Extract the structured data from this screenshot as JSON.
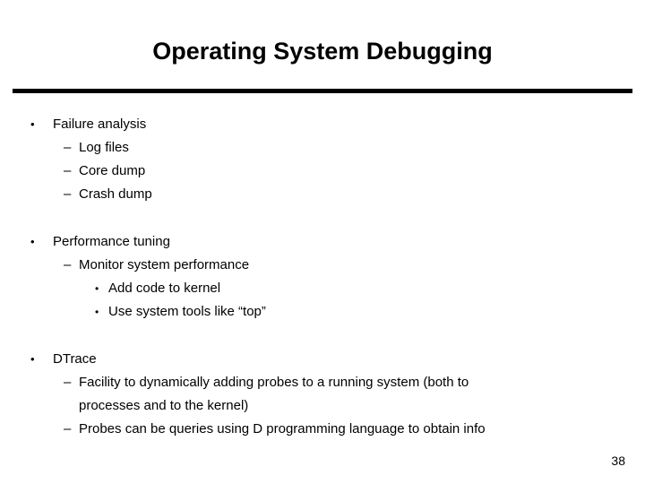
{
  "slide": {
    "title": "Operating System Debugging",
    "page_number": "38",
    "text_color": "#000000",
    "background_color": "#ffffff",
    "rule_color": "#000000",
    "markers": {
      "level1": "•",
      "level2": "–",
      "level3": "•"
    },
    "sections": [
      {
        "heading": "Failure analysis",
        "items": [
          {
            "level": 2,
            "text": "Log files"
          },
          {
            "level": 2,
            "text": "Core dump"
          },
          {
            "level": 2,
            "text": "Crash dump"
          }
        ]
      },
      {
        "heading": "Performance tuning",
        "items": [
          {
            "level": 2,
            "text": "Monitor system performance"
          },
          {
            "level": 3,
            "text": "Add code to kernel"
          },
          {
            "level": 3,
            "text": "Use system tools like “top”"
          }
        ]
      },
      {
        "heading": "DTrace",
        "items": [
          {
            "level": 2,
            "text": "Facility to dynamically adding probes to a running system (both to"
          },
          {
            "level": 2,
            "continuation": true,
            "text": "processes and to the kernel)"
          },
          {
            "level": 2,
            "text": "Probes can be queries using D programming language to obtain info"
          }
        ]
      }
    ]
  }
}
